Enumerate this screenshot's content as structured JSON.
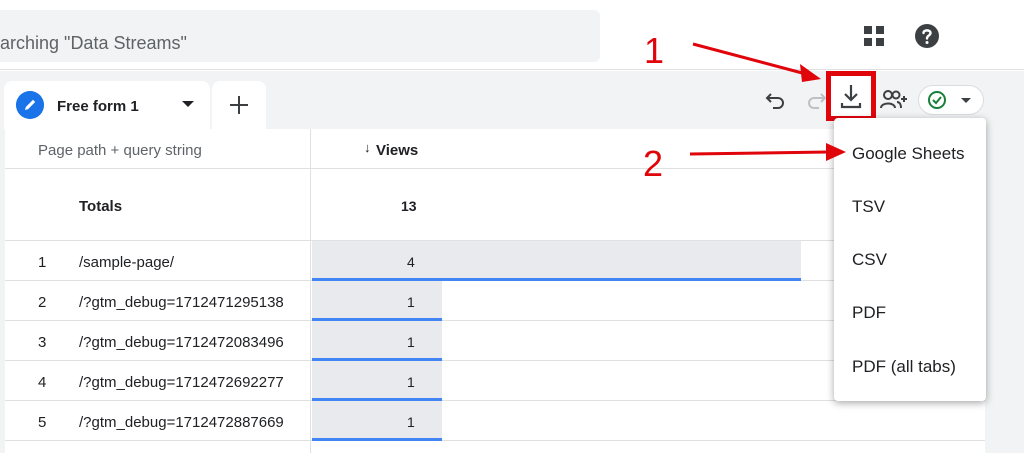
{
  "search": {
    "placeholder": "earching \"Data Streams\""
  },
  "header": {
    "apps_icon": "apps-grid-icon",
    "help_icon": "help-icon"
  },
  "tab": {
    "label": "Free form 1",
    "icon": "pencil-icon"
  },
  "toolbar": {
    "icons": [
      "undo-icon",
      "redo-icon",
      "download-icon",
      "share-users-icon",
      "check-circle-icon"
    ],
    "highlight_color": "#e0040b"
  },
  "table": {
    "dimension_header": "Page path + query string",
    "metric_header": "Views",
    "sort_arrow": "↓",
    "totals_label": "Totals",
    "totals_value": "13",
    "rows": [
      {
        "index": "1",
        "path": "/sample-page/",
        "value": "4",
        "share": 0.94
      },
      {
        "index": "2",
        "path": "/?gtm_debug=1712471295138",
        "value": "1",
        "share": 0.25
      },
      {
        "index": "3",
        "path": "/?gtm_debug=1712472083496",
        "value": "1",
        "share": 0.25
      },
      {
        "index": "4",
        "path": "/?gtm_debug=1712472692277",
        "value": "1",
        "share": 0.25
      },
      {
        "index": "5",
        "path": "/?gtm_debug=1712472887669",
        "value": "1",
        "share": 0.25
      }
    ]
  },
  "menu": {
    "items": [
      "Google Sheets",
      "TSV",
      "CSV",
      "PDF",
      "PDF (all tabs)"
    ]
  },
  "annotations": {
    "step1": "1",
    "step2": "2",
    "color": "#e0040b"
  },
  "colors": {
    "accent": "#1a73e8",
    "bar_line": "#4285f4",
    "bar_fill": "#e8eaed"
  }
}
